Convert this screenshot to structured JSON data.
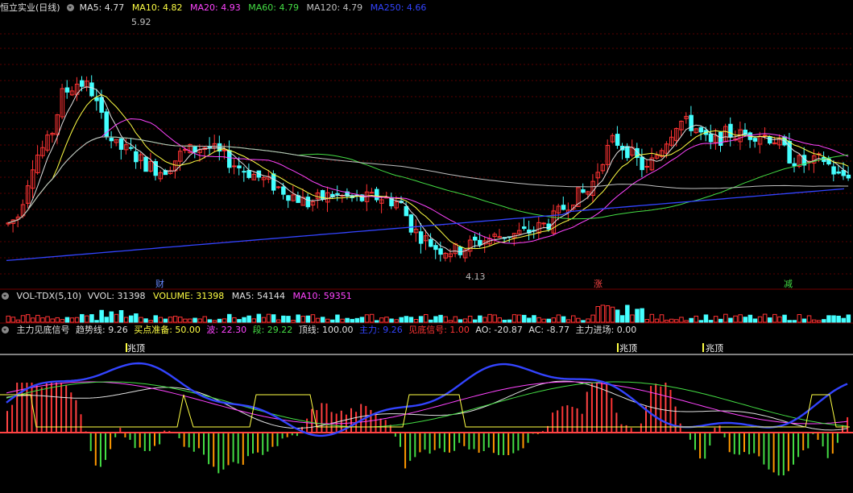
{
  "chart_data": [
    {
      "type": "candlestick",
      "title": "恒立实业(日线)",
      "legend": [
        {
          "label": "MA5: 4.77",
          "color": "#e0e0e0"
        },
        {
          "label": "MA10: 4.82",
          "color": "#ffff44"
        },
        {
          "label": "MA20: 4.93",
          "color": "#ff44ff"
        },
        {
          "label": "MA60: 4.79",
          "color": "#44dd44"
        },
        {
          "label": "MA120: 4.79",
          "color": "#c0c0c0"
        },
        {
          "label": "MA250: 4.66",
          "color": "#3344ff"
        }
      ],
      "annotations": {
        "high": "5.92",
        "low": "4.13"
      },
      "markers": [
        "财",
        "涨",
        "减"
      ],
      "grid": true
    },
    {
      "type": "bar",
      "title": "VOL-TDX(5,10)",
      "legend": [
        {
          "label": "VVOL: 31398",
          "color": "#e0e0e0"
        },
        {
          "label": "VOLUME: 31398",
          "color": "#ffff44"
        },
        {
          "label": "MA5: 54144",
          "color": "#e0e0e0"
        },
        {
          "label": "MA10: 59351",
          "color": "#ff44ff"
        }
      ]
    },
    {
      "type": "bar",
      "title": "主力见底信号",
      "legend": [
        {
          "label": "趋势线: 9.26",
          "color": "#e0e0e0"
        },
        {
          "label": "买点准备: 50.00",
          "color": "#ffff44"
        },
        {
          "label": "波: 22.30",
          "color": "#ff44ff"
        },
        {
          "label": "段: 29.22",
          "color": "#44dd44"
        },
        {
          "label": "顶线: 100.00",
          "color": "#e0e0e0"
        },
        {
          "label": "主力: 9.26",
          "color": "#3344ff"
        },
        {
          "label": "见底信号: 1.00",
          "color": "#ff3333"
        },
        {
          "label": "AO: -20.87",
          "color": "#e0e0e0"
        },
        {
          "label": "AC: -8.77",
          "color": "#e0e0e0"
        },
        {
          "label": "主力进场: 0.00",
          "color": "#e0e0e0"
        }
      ],
      "markers": [
        "兆顶",
        "兆顶",
        "兆顶"
      ]
    }
  ],
  "colors": {
    "up": "#ff3333",
    "down": "#44ffff",
    "ma5": "#e0e0e0",
    "ma10": "#ffff44",
    "ma20": "#ff44ff",
    "ma60": "#44dd44",
    "ma120": "#c0c0c0",
    "ma250": "#3344ff"
  }
}
